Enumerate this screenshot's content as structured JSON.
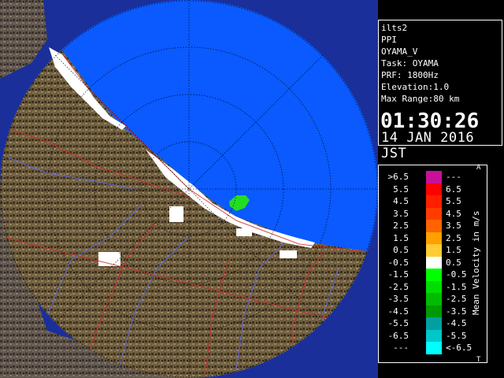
{
  "info_panel": {
    "lines": [
      "ilts2",
      "PPI",
      "OYAMA_V",
      "Task: OYAMA",
      "PRF: 1800Hz",
      "Elevation:1.0",
      "Max Range:80 km"
    ],
    "time": "01:30:26",
    "date": "14 JAN 2016 JST"
  },
  "legend": {
    "unit_label": "Mean Velocity in m/s",
    "corner_top": "A",
    "corner_bottom": "T",
    "rows": [
      {
        "left": ">6.5",
        "right": "---",
        "color": "#c8109a"
      },
      {
        "left": "5.5",
        "right": "6.5",
        "color": "#ff0000"
      },
      {
        "left": "4.5",
        "right": "5.5",
        "color": "#ff1e00"
      },
      {
        "left": "3.5",
        "right": "4.5",
        "color": "#ff3c00"
      },
      {
        "left": "2.5",
        "right": "3.5",
        "color": "#ff6400"
      },
      {
        "left": "1.5",
        "right": "2.5",
        "color": "#ffa000"
      },
      {
        "left": "0.5",
        "right": "1.5",
        "color": "#ffcc33"
      },
      {
        "left": "-0.5",
        "right": "0.5",
        "color": "#ffffff"
      },
      {
        "left": "-1.5",
        "right": "-0.5",
        "color": "#00ff00"
      },
      {
        "left": "-2.5",
        "right": "-1.5",
        "color": "#00dd00"
      },
      {
        "left": "-3.5",
        "right": "-2.5",
        "color": "#00bb00"
      },
      {
        "left": "-4.5",
        "right": "-3.5",
        "color": "#009900"
      },
      {
        "left": "-5.5",
        "right": "-4.5",
        "color": "#00a0a0"
      },
      {
        "left": "-6.5",
        "right": "-5.5",
        "color": "#00c8c8"
      },
      {
        "left": "---",
        "right": "<-6.5",
        "color": "#00ffff"
      }
    ]
  },
  "map": {
    "sea_color": "#0a5aff",
    "deep_sea_color": "#1a2f9a",
    "land_color": "#6b5a3c",
    "range_ring_color": "#000000"
  }
}
